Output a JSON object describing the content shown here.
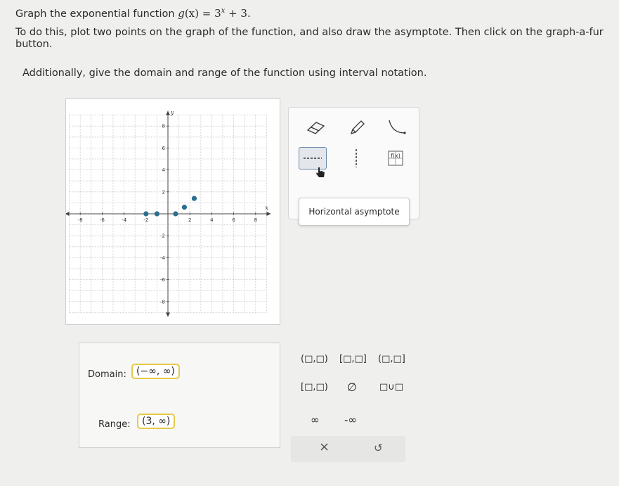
{
  "problem": {
    "line1_prefix": "Graph the exponential function",
    "function_name": "g",
    "function_arg": "(x)",
    "function_eq": "= 3",
    "function_exp": "x",
    "function_tail": " + 3.",
    "line2": "To do this, plot two points on the graph of the function, and also draw the asymptote. Then click on the graph-a-fur",
    "line3": "button.",
    "line4": "Additionally, give the domain and range of the function using interval notation."
  },
  "graph": {
    "x_axis_label": "x",
    "y_axis_label": "y",
    "x_tick_labels": [
      "-8",
      "-6",
      "-4",
      "-2",
      "2",
      "4",
      "6",
      "8"
    ],
    "y_tick_labels": [
      "8",
      "6",
      "4",
      "2",
      "-2",
      "-4",
      "-6",
      "-8"
    ],
    "point_color": "#2c6e8f",
    "axis_range": [
      -9,
      9
    ],
    "plotted_points": [
      {
        "x": -2,
        "y": 0
      },
      {
        "x": -1,
        "y": 0
      },
      {
        "x": 0.7,
        "y": 0
      },
      {
        "x": 1.5,
        "y": 0.6
      },
      {
        "x": 2.4,
        "y": 1.4
      }
    ]
  },
  "tools": {
    "items": [
      "eraser",
      "pencil",
      "curve",
      "dashed-line",
      "vertical-dashed-line",
      "graph-a-function"
    ],
    "selected": "dashed-line",
    "tooltip": "Horizontal asymptote"
  },
  "answers": {
    "domain_label": "Domain:",
    "domain_value": "(−∞, ∞)",
    "range_label": "Range:",
    "range_value": "(3, ∞)",
    "highlight_color": "#e6c94a"
  },
  "symbols": {
    "open_open": "(□,□)",
    "closed_closed": "[□,□]",
    "open_closed": "(□,□]",
    "closed_open": "[□,□)",
    "empty_set": "∅",
    "union": "□∪□",
    "infinity": "∞",
    "neg_infinity": "-∞"
  },
  "actions": {
    "clear": "×",
    "undo": "↺"
  }
}
